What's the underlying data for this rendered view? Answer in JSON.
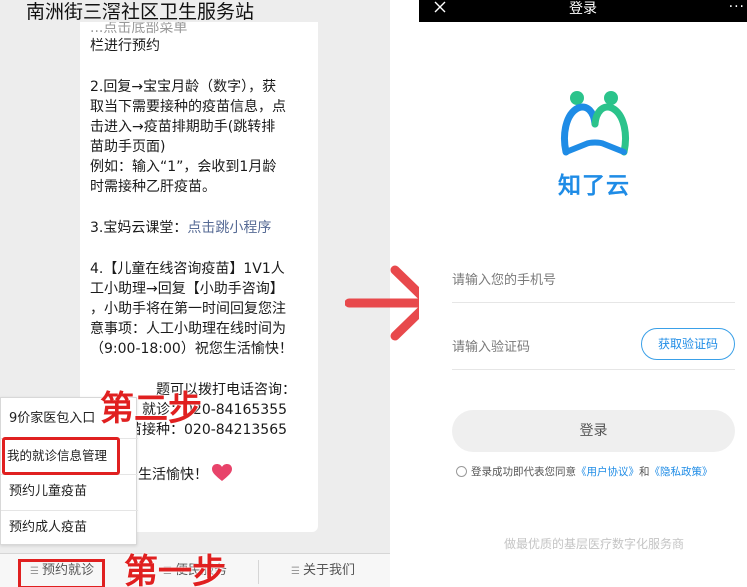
{
  "left": {
    "chat_title": "南洲街三滘社区卫生服务站",
    "bubble_lines": {
      "l0": "...点击底部菜单",
      "l1": "栏进行预约",
      "l2": "2.回复→宝宝月龄（数字），获",
      "l3": "取当下需要接种的疫苗信息，点",
      "l4": "击进入→疫苗排期助手(跳转排",
      "l5": "苗助手页面)",
      "l6": "例如：输入“1”，会收到1月龄",
      "l7": "时需接种乙肝疫苗。",
      "l8_prefix": "3.宝妈云课堂：",
      "l8_link": "点击跳小程序",
      "l9": "4.【儿童在线咨询疫苗】1V1人",
      "l10": "工小助理→回复【小助手咨询】",
      "l11": "，小助手将在第一时间回复您注",
      "l12": "意事项：人工小助理在线时间为",
      "l13": "（9:00-18:00）祝您生活愉快！",
      "l14": "题可以拨打电话咨询：",
      "l15": "就诊：020-84165355",
      "l16": "疫苗接种：020-84213565",
      "l17": "生活愉快！"
    },
    "menu": {
      "items": [
        "9价家医包入口",
        "我的就诊信息管理",
        "预约儿童疫苗",
        "预约成人疫苗"
      ]
    },
    "menubar": {
      "items": [
        "预约就诊",
        "便民服务",
        "关于我们"
      ]
    },
    "steps": {
      "step1": "第一步",
      "step2": "第二步"
    }
  },
  "right": {
    "header_title": "登录",
    "more": "···",
    "brand": "知了云",
    "phone_placeholder": "请输入您的手机号",
    "code_placeholder": "请输入验证码",
    "code_button": "获取验证码",
    "login_button": "登录",
    "agree_prefix": "登录成功即代表您同意",
    "agree_link1": "《用户协议》",
    "agree_and": "和",
    "agree_link2": "《隐私政策》",
    "slogan": "做最优质的基层医疗数字化服务商"
  },
  "colors": {
    "accent_blue": "#1f8ce6",
    "logo_green": "#2bc38b",
    "annotation_red": "#e02020"
  }
}
